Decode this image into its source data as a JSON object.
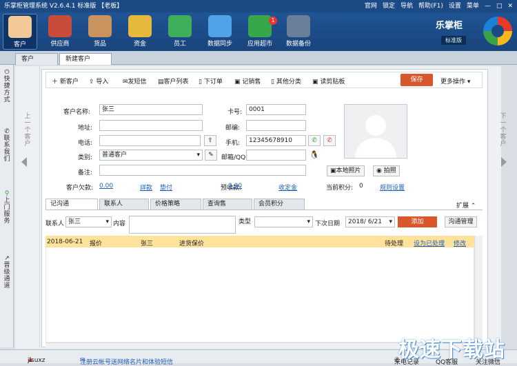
{
  "window": {
    "title": "乐掌柜管理系统 V2.6.4.1 标准版 【老板】",
    "links": [
      "官网",
      "锁定",
      "导航",
      "帮助(F1)",
      "设置",
      "菜单"
    ]
  },
  "toolbar": [
    "客户",
    "供应商",
    "货品",
    "资金",
    "员工",
    "数据同步",
    "应用超市",
    "数据备份"
  ],
  "badge": "1",
  "brand": {
    "name": "乐掌柜",
    "edition": "标准版"
  },
  "tabs": [
    "客户",
    "新建客户"
  ],
  "leftnav": [
    "快捷方式",
    "联系我们",
    "上门服务",
    "晋级通道"
  ],
  "prev_label": "上一个客户",
  "next_label": "下一个客户",
  "actions": [
    "新客户",
    "导入",
    "发短信",
    "客户列表",
    "下订单",
    "记销售",
    "其他分类",
    "读剪贴板"
  ],
  "save": "保存",
  "more": "更多操作",
  "form": {
    "name_label": "客户名称:",
    "name": "张三",
    "addr_label": "地址:",
    "phone_label": "电话:",
    "type_label": "类别:",
    "type": "普通客户",
    "note_label": "备注:",
    "owe_label": "客户欠款:",
    "owe": "0.00",
    "owe_link1": "詳款",
    "owe_link2": "垫付",
    "card_label": "卡号:",
    "card": "0001",
    "zip_label": "邮编:",
    "mobile_label": "手机:",
    "mobile": "12345678910",
    "mail_label": "邮箱/QQ",
    "pre_label": "预收款:",
    "pre": "0.00",
    "pre_link": "收定金",
    "point_label": "当前积分:",
    "point": "0",
    "point_link": "规则设置"
  },
  "photo_buttons": [
    "本地照片",
    "拍照"
  ],
  "subtabs": [
    "记沟通",
    "联系人",
    "价格策略",
    "查询售",
    "会员积分"
  ],
  "expand": "扩展",
  "filter": {
    "contact_label": "联系人",
    "contact": "张三",
    "content_label": "内容",
    "type_label": "类型",
    "next_label": "下次日期",
    "date": "2018/ 6/21",
    "add": "添加",
    "manage": "沟通管理"
  },
  "row": {
    "date": "2018-06-21",
    "kind": "报价",
    "person": "张三",
    "text": "进货保价",
    "status": "待处理",
    "op1": "设为已处理",
    "op2": "修改"
  },
  "status": {
    "user": "jisuxz",
    "notice": "注册云帐号送网络名片和体验短信",
    "call": "来电记录",
    "qq": "QQ客服",
    "wechat": "关注微信"
  },
  "watermark": "极速下载站"
}
